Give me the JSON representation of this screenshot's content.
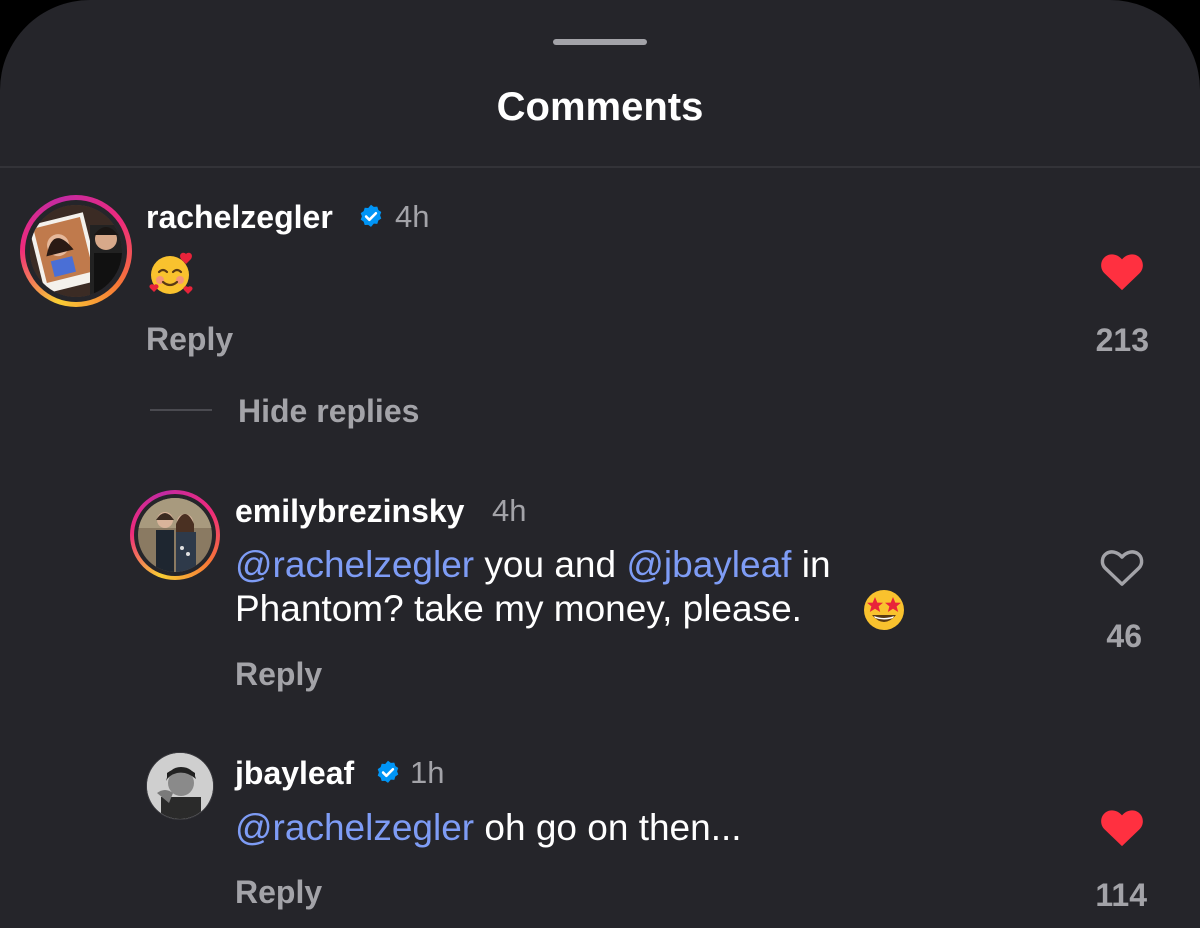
{
  "sheet": {
    "title": "Comments"
  },
  "comments": [
    {
      "username": "rachelzegler",
      "verified": true,
      "time": "4h",
      "text_emoji": "🥰",
      "reply_label": "Reply",
      "liked": true,
      "like_count": "213"
    }
  ],
  "thread": {
    "hide_replies_label": "Hide replies"
  },
  "replies": [
    {
      "username": "emilybrezinsky",
      "verified": false,
      "time": "4h",
      "line1_mention1": "@rachelzegler",
      "line1_text": " you and ",
      "line1_mention2": "@jbayleaf",
      "line1_text2": " in",
      "line2_text": "Phantom? take my money, please.",
      "line2_emoji": "🤩",
      "reply_label": "Reply",
      "liked": false,
      "like_count": "46"
    },
    {
      "username": "jbayleaf",
      "verified": true,
      "time": "1h",
      "mention": "@rachelzegler",
      "text": " oh go on then...",
      "reply_label": "Reply",
      "liked": true,
      "like_count": "114"
    }
  ],
  "colors": {
    "background": "#25252a",
    "mention": "#7e9cf5",
    "like_active": "#ff3040",
    "verified": "#0095f6",
    "secondary_text": "#a3a3a8"
  },
  "icons": {
    "verified": "verified-badge-icon",
    "like_filled": "heart-filled-icon",
    "like_outline": "heart-outline-icon"
  }
}
